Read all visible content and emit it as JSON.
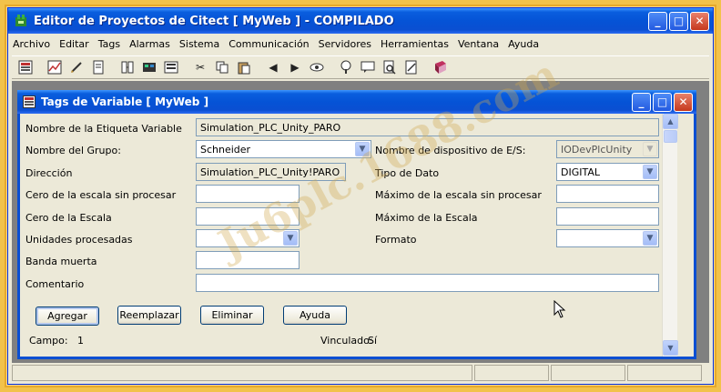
{
  "app": {
    "title": "Editor de Proyectos de Citect [ MyWeb ] - COMPILADO",
    "menu": [
      "Archivo",
      "Editar",
      "Tags",
      "Alarmas",
      "Sistema",
      "Communicación",
      "Servidores",
      "Herramientas",
      "Ventana",
      "Ayuda"
    ]
  },
  "window_buttons": {
    "minimize": "_",
    "maximize": "□",
    "close": "✕"
  },
  "toolbar": {
    "icons": [
      "variable-tags-icon",
      "trends-icon",
      "pen-icon",
      "document-icon",
      "io-devices-icon",
      "boards-icon",
      "ports-icon",
      "cut-icon",
      "copy-icon",
      "paste-icon",
      "previous-icon",
      "next-icon",
      "view-icon",
      "tree-icon",
      "comment-icon",
      "find-icon",
      "edit-icon",
      "help-book-icon"
    ]
  },
  "child": {
    "title": "Tags de Variable [ MyWeb ]"
  },
  "form": {
    "tag_name_label": "Nombre de la Etiqueta Variable",
    "tag_name_value": "Simulation_PLC_Unity_PARO",
    "group_label": "Nombre del Grupo:",
    "group_value": "Schneider",
    "io_device_label": "Nombre de dispositivo de E/S:",
    "io_device_value": "IODevPlcUnity",
    "address_label": "Dirección",
    "address_value": "Simulation_PLC_Unity!PARO",
    "data_type_label": "Tipo de Dato",
    "data_type_value": "DIGITAL",
    "raw_zero_label": "Cero de la escala sin procesar",
    "raw_zero_value": "",
    "raw_full_label": "Máximo de la escala sin procesar",
    "raw_full_value": "",
    "eng_zero_label": "Cero de la Escala",
    "eng_zero_value": "",
    "eng_full_label": "Máximo de la Escala",
    "eng_full_value": "",
    "eng_units_label": "Unidades procesadas",
    "eng_units_value": "",
    "format_label": "Formato",
    "format_value": "",
    "deadband_label": "Banda muerta",
    "deadband_value": "",
    "comment_label": "Comentario",
    "comment_value": ""
  },
  "buttons": {
    "add": "Agregar",
    "replace": "Reemplazar",
    "delete": "Eliminar",
    "help": "Ayuda"
  },
  "record": {
    "field_label": "Campo:",
    "field_value": "1",
    "linked_label": "Vinculado:",
    "linked_value": "Sí"
  },
  "watermark": "Ju6plc.1688.com",
  "colors": {
    "titlebar_blue": "#0553d6",
    "window_face": "#ece9d8",
    "frame_gold": "#f2c24a"
  }
}
